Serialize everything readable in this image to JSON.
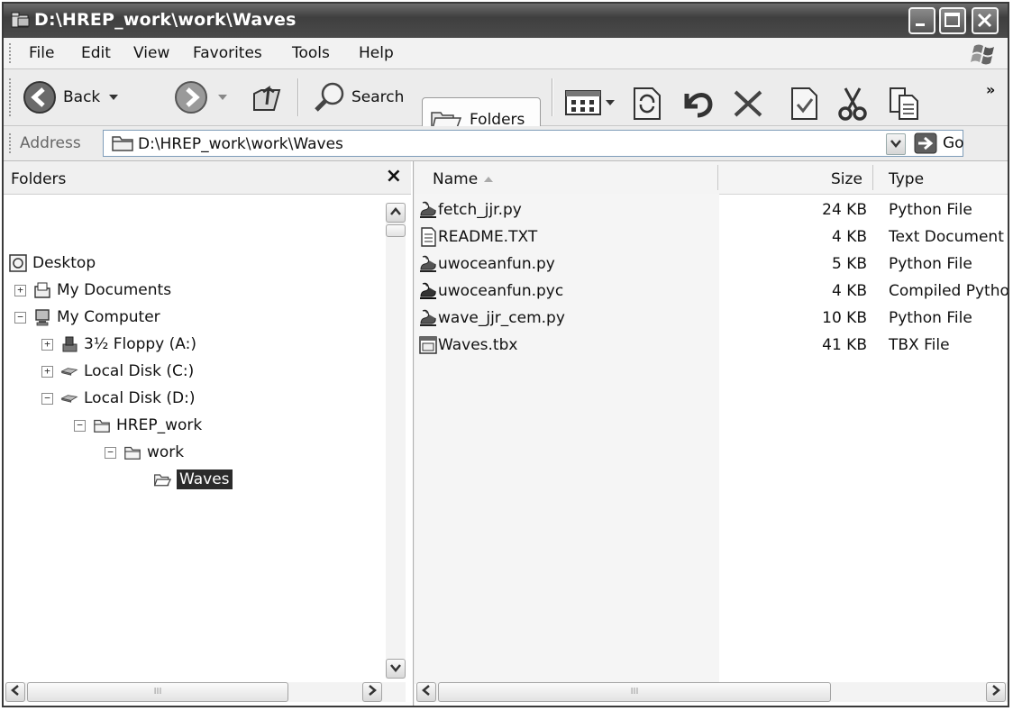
{
  "window": {
    "title": "D:\\HREP_work\\work\\Waves"
  },
  "menu": {
    "items": [
      "File",
      "Edit",
      "View",
      "Favorites",
      "Tools",
      "Help"
    ]
  },
  "toolbar": {
    "back_label": "Back",
    "search_label": "Search",
    "folders_label": "Folders",
    "chevron": "»"
  },
  "address": {
    "label": "Address",
    "value": "D:\\HREP_work\\work\\Waves",
    "go_label": "Go"
  },
  "folders_pane": {
    "title": "Folders",
    "close": "×",
    "tree": [
      {
        "label": "Desktop",
        "icon": "desktop-icon",
        "expander": ""
      },
      {
        "label": "My Documents",
        "icon": "my-documents-icon",
        "expander": "+"
      },
      {
        "label": "My Computer",
        "icon": "my-computer-icon",
        "expander": "−"
      },
      {
        "label": "3½ Floppy (A:)",
        "icon": "floppy-icon",
        "expander": "+"
      },
      {
        "label": "Local Disk (C:)",
        "icon": "disk-icon",
        "expander": "+"
      },
      {
        "label": "Local Disk (D:)",
        "icon": "disk-icon",
        "expander": "−"
      },
      {
        "label": "HREP_work",
        "icon": "folder-icon",
        "expander": "−"
      },
      {
        "label": "work",
        "icon": "folder-icon",
        "expander": "−"
      },
      {
        "label": "Waves",
        "icon": "folder-open-icon",
        "expander": ""
      }
    ]
  },
  "files_pane": {
    "columns": {
      "name": "Name",
      "size": "Size",
      "type": "Type"
    },
    "files": [
      {
        "name": "fetch_jjr.py",
        "size": "24 KB",
        "type": "Python File",
        "icon": "python-file-icon"
      },
      {
        "name": "README.TXT",
        "size": "4 KB",
        "type": "Text Document",
        "icon": "text-file-icon"
      },
      {
        "name": "uwoceanfun.py",
        "size": "5 KB",
        "type": "Python File",
        "icon": "python-file-icon"
      },
      {
        "name": "uwoceanfun.pyc",
        "size": "4 KB",
        "type": "Compiled Python",
        "icon": "python-file-icon"
      },
      {
        "name": "wave_jjr_cem.py",
        "size": "10 KB",
        "type": "Python File",
        "icon": "python-file-icon"
      },
      {
        "name": "Waves.tbx",
        "size": "41 KB",
        "type": "TBX File",
        "icon": "tbx-file-icon"
      }
    ]
  },
  "scrollbars": {
    "left_arrow": "<",
    "right_arrow": ">",
    "up_arrow": "^",
    "down_arrow": "v",
    "thumb_grip": "III"
  }
}
